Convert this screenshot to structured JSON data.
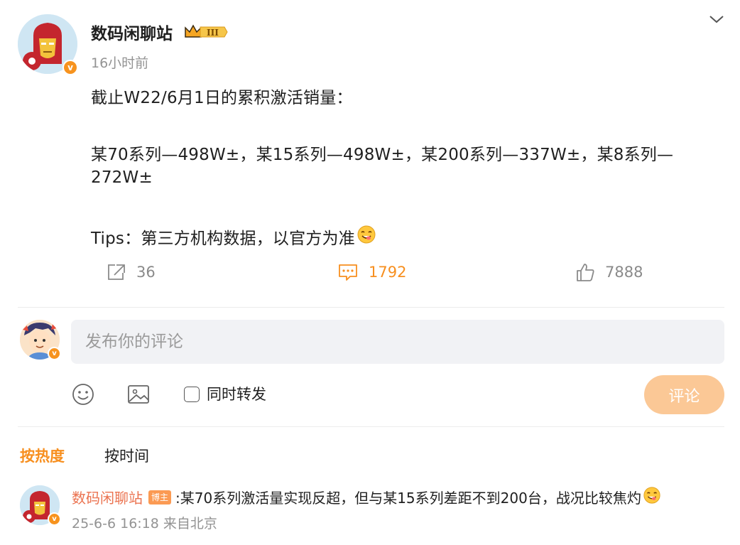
{
  "post": {
    "author": "数码闲聊站",
    "time": "16小时前",
    "lines": [
      "截止W22/6月1日的累积激活销量：",
      "某70系列—498W±，某15系列—498W±，某200系列—337W±，某8系列—",
      "272W±",
      "Tips：第三方机构数据，以官方为准"
    ],
    "reposts": "36",
    "comments": "1792",
    "likes": "7888"
  },
  "composer": {
    "placeholder": "发布你的评论",
    "repost_label": "同时转发",
    "submit_label": "评论"
  },
  "sort_tabs": [
    "按热度",
    "按时间"
  ],
  "comment": {
    "author": "数码闲聊站",
    "tag": "博主",
    "text": ":某70系列激活量实现反超，但与某15系列差距不到200台，战况比较焦灼",
    "meta": "25-6-6 16:18 来自北京"
  },
  "icons": {
    "verified": "verified-v-badge",
    "membership": "crown-level-badge",
    "emoji": "yum-face-emoji"
  },
  "colors": {
    "accent": "#f78f1f",
    "comment_author": "#eb7350",
    "submit_disabled": "#fbc896"
  }
}
